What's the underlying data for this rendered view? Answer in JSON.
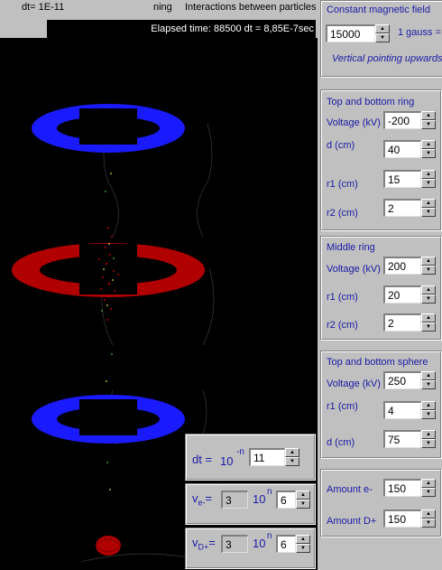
{
  "topbar": {
    "dt_label": "dt= 1E-11",
    "overlay_text": "ning",
    "interactions_label": "Interactions between particles"
  },
  "elapsed": {
    "text": "Elapsed time: 88500 dt   = 8,85E-7sec"
  },
  "magnetic": {
    "title": "Constant magnetic field",
    "value": "15000",
    "unit": "1 gauss =",
    "direction": "Vertical pointing upwards (f"
  },
  "top_bottom_ring": {
    "title": "Top and bottom ring",
    "voltage_label": "Voltage (kV)",
    "voltage": "-200",
    "d_label": "d (cm)",
    "d": "40",
    "r1_label": "r1 (cm)",
    "r1": "15",
    "r2_label": "r2 (cm)",
    "r2": "2"
  },
  "middle_ring": {
    "title": "Middle ring",
    "voltage_label": "Voltage (kV)",
    "voltage": "200",
    "r1_label": "r1 (cm)",
    "r1": "20",
    "r2_label": "r2 (cm)",
    "r2": "2"
  },
  "sphere": {
    "title": "Top and bottom sphere",
    "voltage_label": "Voltage (kV)",
    "voltage": "250",
    "r1_label": "r1 (cm)",
    "r1": "4",
    "d_label": "d (cm)",
    "d": "75"
  },
  "amounts": {
    "e_label": "Amount e-",
    "e": "150",
    "d_label": "Amount D+",
    "d": "150"
  },
  "dt_panel": {
    "label": "dt =",
    "base": "10",
    "exp": "-n",
    "value": "11"
  },
  "ve_panel": {
    "label_main": "v",
    "label_sub": "e-",
    "label_eq": "=",
    "mantissa": "3",
    "base": "10",
    "exp": "n",
    "value": "6"
  },
  "vd_panel": {
    "label_main": "v",
    "label_sub": "D+",
    "label_eq": "=",
    "mantissa": "3",
    "base": "10",
    "exp": "n",
    "value": "6"
  },
  "colors": {
    "ring_blue": "#1a1aff",
    "ring_red": "#b00000",
    "label_blue": "#1a1aa6"
  }
}
